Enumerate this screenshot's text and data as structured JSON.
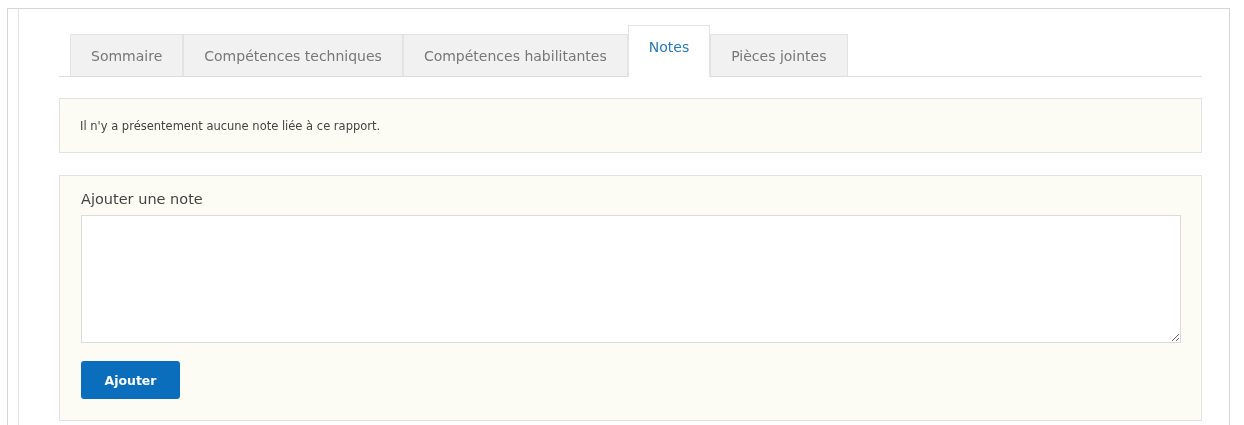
{
  "tabs": [
    {
      "label": "Sommaire",
      "selected": false
    },
    {
      "label": "Compétences techniques",
      "selected": false
    },
    {
      "label": "Compétences habilitantes",
      "selected": false
    },
    {
      "label": "Notes",
      "selected": true
    },
    {
      "label": "Pièces jointes",
      "selected": false
    }
  ],
  "message": "Il n'y a présentement aucune note liée à ce rapport.",
  "note_form": {
    "label": "Ajouter une note",
    "button": "Ajouter"
  }
}
